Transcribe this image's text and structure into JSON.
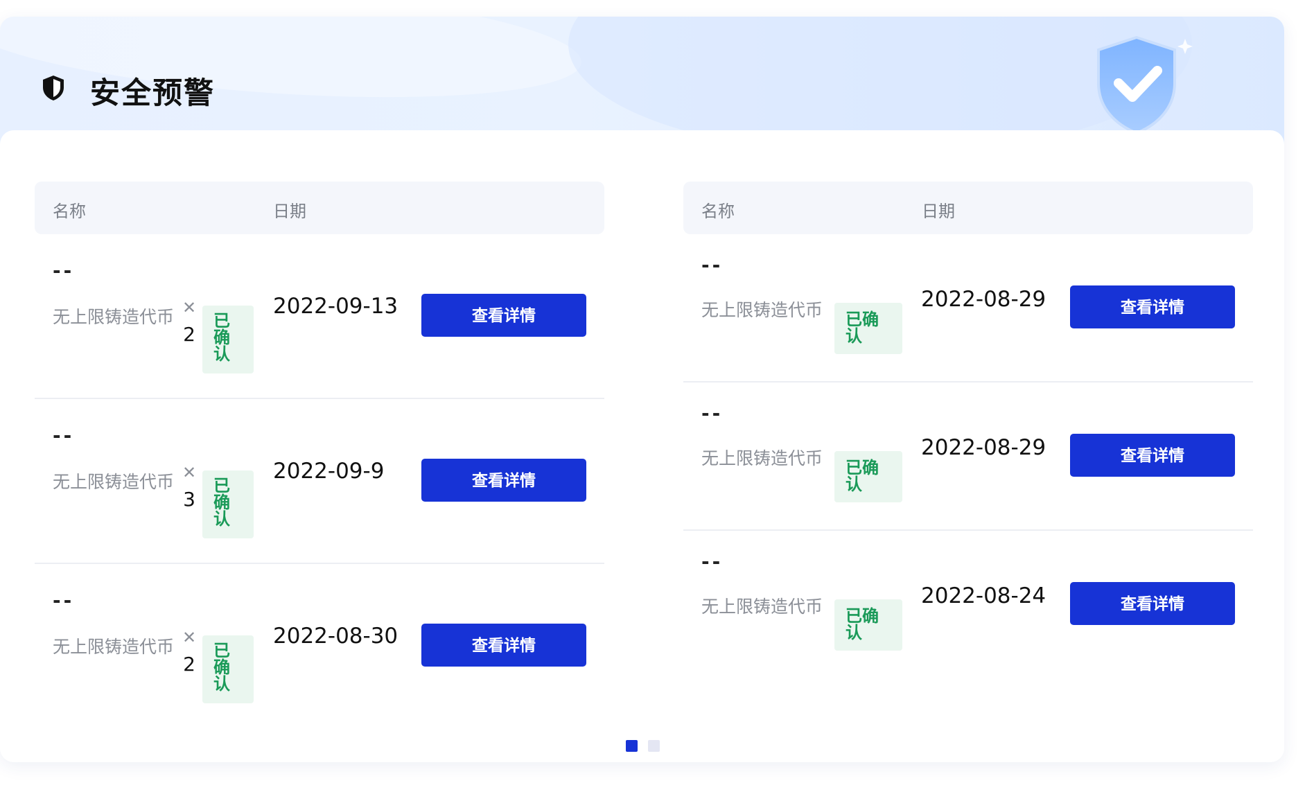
{
  "header": {
    "title": "安全预警",
    "icon": "shield-half-icon",
    "illustration": "shield-check-icon"
  },
  "columns": {
    "name": "名称",
    "date": "日期"
  },
  "left_table": {
    "rows": [
      {
        "dash": "--",
        "name": "无上限铸造代币",
        "multiplier": "✕",
        "count": "2",
        "status": "已确认",
        "date": "2022-09-13",
        "action": "查看详情"
      },
      {
        "dash": "--",
        "name": "无上限铸造代币",
        "multiplier": "✕",
        "count": "3",
        "status": "已确认",
        "date": "2022-09-9",
        "action": "查看详情"
      },
      {
        "dash": "--",
        "name": "无上限铸造代币",
        "multiplier": "✕",
        "count": "2",
        "status": "已确认",
        "date": "2022-08-30",
        "action": "查看详情"
      }
    ]
  },
  "right_table": {
    "rows": [
      {
        "dash": "--",
        "name": "无上限铸造代币",
        "status": "已确认",
        "date": "2022-08-29",
        "action": "查看详情"
      },
      {
        "dash": "--",
        "name": "无上限铸造代币",
        "status": "已确认",
        "date": "2022-08-29",
        "action": "查看详情"
      },
      {
        "dash": "--",
        "name": "无上限铸造代币",
        "status": "已确认",
        "date": "2022-08-24",
        "action": "查看详情"
      }
    ]
  },
  "pagination": {
    "pages": 2,
    "current": 1
  },
  "colors": {
    "accent": "#1733d6",
    "status_text": "#1a9a58",
    "status_bg": "#eaf6ef",
    "header_bg": "#e7f0ff"
  }
}
